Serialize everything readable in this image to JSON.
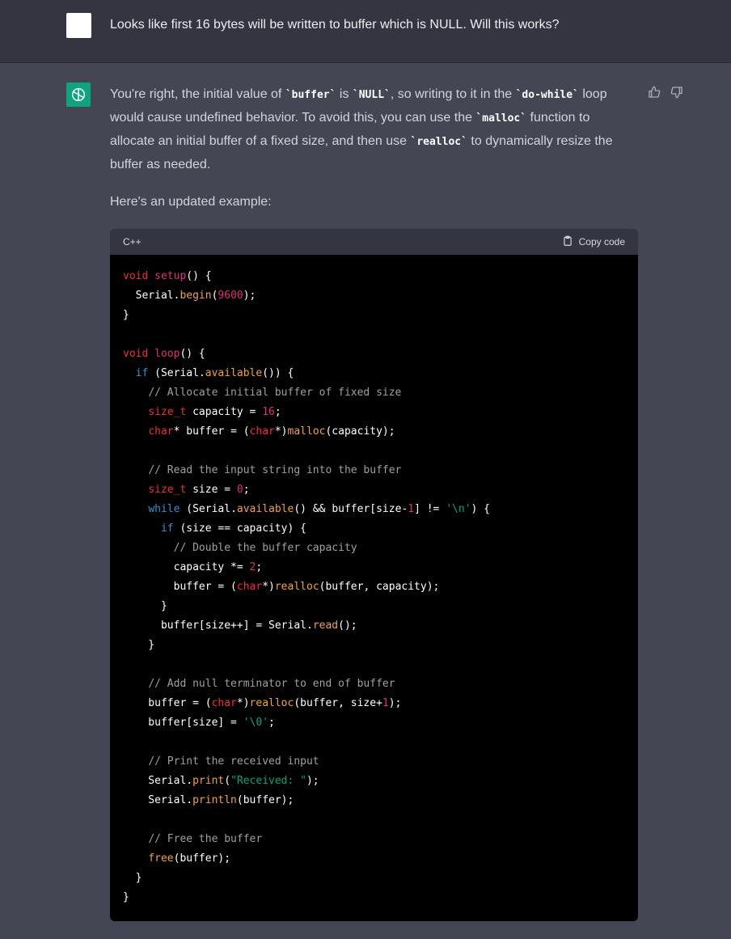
{
  "user_message": {
    "text": "Looks like first 16 bytes will be written to buffer which is NULL. Will this works?"
  },
  "assistant_message": {
    "p1_a": "You're right, the initial value of ",
    "p1_code1": "`buffer`",
    "p1_b": " is ",
    "p1_code2": "`NULL`",
    "p1_c": ", so writing to it in the ",
    "p1_code3": "`do-while`",
    "p1_d": " loop would cause undefined behavior. To avoid this, you can use the ",
    "p1_code4": "`malloc`",
    "p1_e": " function to allocate an initial buffer of a fixed size, and then use ",
    "p1_code5": "`realloc`",
    "p1_f": " to dynamically resize the buffer as needed.",
    "p2": "Here's an updated example:"
  },
  "code_block": {
    "language": "C++",
    "copy_label": "Copy code",
    "lines": [
      "void setup() {",
      "  Serial.begin(9600);",
      "}",
      "",
      "void loop() {",
      "  if (Serial.available()) {",
      "    // Allocate initial buffer of fixed size",
      "    size_t capacity = 16;",
      "    char* buffer = (char*)malloc(capacity);",
      "",
      "    // Read the input string into the buffer",
      "    size_t size = 0;",
      "    while (Serial.available() && buffer[size-1] != '\\n') {",
      "      if (size == capacity) {",
      "        // Double the buffer capacity",
      "        capacity *= 2;",
      "        buffer = (char*)realloc(buffer, capacity);",
      "      }",
      "      buffer[size++] = Serial.read();",
      "    }",
      "",
      "    // Add null terminator to end of buffer",
      "    buffer = (char*)realloc(buffer, size+1);",
      "    buffer[size] = '\\0';",
      "",
      "    // Print the received input",
      "    Serial.print(\"Received: \");",
      "    Serial.println(buffer);",
      "",
      "    // Free the buffer",
      "    free(buffer);",
      "  }",
      "}"
    ]
  },
  "icons": {
    "avatar_user": "user-avatar",
    "avatar_assistant": "openai-logo-icon",
    "thumbs_up": "thumbs-up-icon",
    "thumbs_down": "thumbs-down-icon",
    "clipboard": "clipboard-icon"
  },
  "colors": {
    "user_bg": "#343541",
    "assistant_bg": "#444654",
    "brand": "#10a37f",
    "code_bg": "#000000"
  }
}
